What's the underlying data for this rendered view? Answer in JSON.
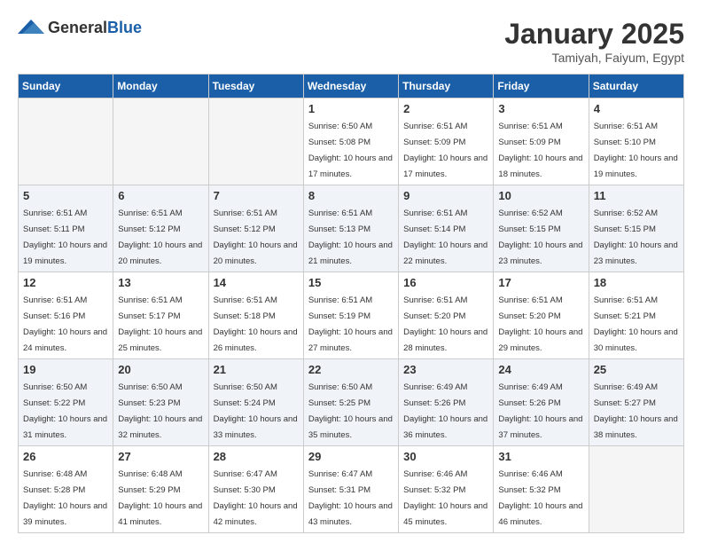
{
  "header": {
    "logo_general": "General",
    "logo_blue": "Blue",
    "title": "January 2025",
    "subtitle": "Tamiyah, Faiyum, Egypt"
  },
  "weekdays": [
    "Sunday",
    "Monday",
    "Tuesday",
    "Wednesday",
    "Thursday",
    "Friday",
    "Saturday"
  ],
  "weeks": [
    [
      {
        "day": "",
        "sunrise": "",
        "sunset": "",
        "daylight": "",
        "empty": true
      },
      {
        "day": "",
        "sunrise": "",
        "sunset": "",
        "daylight": "",
        "empty": true
      },
      {
        "day": "",
        "sunrise": "",
        "sunset": "",
        "daylight": "",
        "empty": true
      },
      {
        "day": "1",
        "sunrise": "Sunrise: 6:50 AM",
        "sunset": "Sunset: 5:08 PM",
        "daylight": "Daylight: 10 hours and 17 minutes.",
        "empty": false
      },
      {
        "day": "2",
        "sunrise": "Sunrise: 6:51 AM",
        "sunset": "Sunset: 5:09 PM",
        "daylight": "Daylight: 10 hours and 17 minutes.",
        "empty": false
      },
      {
        "day": "3",
        "sunrise": "Sunrise: 6:51 AM",
        "sunset": "Sunset: 5:09 PM",
        "daylight": "Daylight: 10 hours and 18 minutes.",
        "empty": false
      },
      {
        "day": "4",
        "sunrise": "Sunrise: 6:51 AM",
        "sunset": "Sunset: 5:10 PM",
        "daylight": "Daylight: 10 hours and 19 minutes.",
        "empty": false
      }
    ],
    [
      {
        "day": "5",
        "sunrise": "Sunrise: 6:51 AM",
        "sunset": "Sunset: 5:11 PM",
        "daylight": "Daylight: 10 hours and 19 minutes.",
        "empty": false
      },
      {
        "day": "6",
        "sunrise": "Sunrise: 6:51 AM",
        "sunset": "Sunset: 5:12 PM",
        "daylight": "Daylight: 10 hours and 20 minutes.",
        "empty": false
      },
      {
        "day": "7",
        "sunrise": "Sunrise: 6:51 AM",
        "sunset": "Sunset: 5:12 PM",
        "daylight": "Daylight: 10 hours and 20 minutes.",
        "empty": false
      },
      {
        "day": "8",
        "sunrise": "Sunrise: 6:51 AM",
        "sunset": "Sunset: 5:13 PM",
        "daylight": "Daylight: 10 hours and 21 minutes.",
        "empty": false
      },
      {
        "day": "9",
        "sunrise": "Sunrise: 6:51 AM",
        "sunset": "Sunset: 5:14 PM",
        "daylight": "Daylight: 10 hours and 22 minutes.",
        "empty": false
      },
      {
        "day": "10",
        "sunrise": "Sunrise: 6:52 AM",
        "sunset": "Sunset: 5:15 PM",
        "daylight": "Daylight: 10 hours and 23 minutes.",
        "empty": false
      },
      {
        "day": "11",
        "sunrise": "Sunrise: 6:52 AM",
        "sunset": "Sunset: 5:15 PM",
        "daylight": "Daylight: 10 hours and 23 minutes.",
        "empty": false
      }
    ],
    [
      {
        "day": "12",
        "sunrise": "Sunrise: 6:51 AM",
        "sunset": "Sunset: 5:16 PM",
        "daylight": "Daylight: 10 hours and 24 minutes.",
        "empty": false
      },
      {
        "day": "13",
        "sunrise": "Sunrise: 6:51 AM",
        "sunset": "Sunset: 5:17 PM",
        "daylight": "Daylight: 10 hours and 25 minutes.",
        "empty": false
      },
      {
        "day": "14",
        "sunrise": "Sunrise: 6:51 AM",
        "sunset": "Sunset: 5:18 PM",
        "daylight": "Daylight: 10 hours and 26 minutes.",
        "empty": false
      },
      {
        "day": "15",
        "sunrise": "Sunrise: 6:51 AM",
        "sunset": "Sunset: 5:19 PM",
        "daylight": "Daylight: 10 hours and 27 minutes.",
        "empty": false
      },
      {
        "day": "16",
        "sunrise": "Sunrise: 6:51 AM",
        "sunset": "Sunset: 5:20 PM",
        "daylight": "Daylight: 10 hours and 28 minutes.",
        "empty": false
      },
      {
        "day": "17",
        "sunrise": "Sunrise: 6:51 AM",
        "sunset": "Sunset: 5:20 PM",
        "daylight": "Daylight: 10 hours and 29 minutes.",
        "empty": false
      },
      {
        "day": "18",
        "sunrise": "Sunrise: 6:51 AM",
        "sunset": "Sunset: 5:21 PM",
        "daylight": "Daylight: 10 hours and 30 minutes.",
        "empty": false
      }
    ],
    [
      {
        "day": "19",
        "sunrise": "Sunrise: 6:50 AM",
        "sunset": "Sunset: 5:22 PM",
        "daylight": "Daylight: 10 hours and 31 minutes.",
        "empty": false
      },
      {
        "day": "20",
        "sunrise": "Sunrise: 6:50 AM",
        "sunset": "Sunset: 5:23 PM",
        "daylight": "Daylight: 10 hours and 32 minutes.",
        "empty": false
      },
      {
        "day": "21",
        "sunrise": "Sunrise: 6:50 AM",
        "sunset": "Sunset: 5:24 PM",
        "daylight": "Daylight: 10 hours and 33 minutes.",
        "empty": false
      },
      {
        "day": "22",
        "sunrise": "Sunrise: 6:50 AM",
        "sunset": "Sunset: 5:25 PM",
        "daylight": "Daylight: 10 hours and 35 minutes.",
        "empty": false
      },
      {
        "day": "23",
        "sunrise": "Sunrise: 6:49 AM",
        "sunset": "Sunset: 5:26 PM",
        "daylight": "Daylight: 10 hours and 36 minutes.",
        "empty": false
      },
      {
        "day": "24",
        "sunrise": "Sunrise: 6:49 AM",
        "sunset": "Sunset: 5:26 PM",
        "daylight": "Daylight: 10 hours and 37 minutes.",
        "empty": false
      },
      {
        "day": "25",
        "sunrise": "Sunrise: 6:49 AM",
        "sunset": "Sunset: 5:27 PM",
        "daylight": "Daylight: 10 hours and 38 minutes.",
        "empty": false
      }
    ],
    [
      {
        "day": "26",
        "sunrise": "Sunrise: 6:48 AM",
        "sunset": "Sunset: 5:28 PM",
        "daylight": "Daylight: 10 hours and 39 minutes.",
        "empty": false
      },
      {
        "day": "27",
        "sunrise": "Sunrise: 6:48 AM",
        "sunset": "Sunset: 5:29 PM",
        "daylight": "Daylight: 10 hours and 41 minutes.",
        "empty": false
      },
      {
        "day": "28",
        "sunrise": "Sunrise: 6:47 AM",
        "sunset": "Sunset: 5:30 PM",
        "daylight": "Daylight: 10 hours and 42 minutes.",
        "empty": false
      },
      {
        "day": "29",
        "sunrise": "Sunrise: 6:47 AM",
        "sunset": "Sunset: 5:31 PM",
        "daylight": "Daylight: 10 hours and 43 minutes.",
        "empty": false
      },
      {
        "day": "30",
        "sunrise": "Sunrise: 6:46 AM",
        "sunset": "Sunset: 5:32 PM",
        "daylight": "Daylight: 10 hours and 45 minutes.",
        "empty": false
      },
      {
        "day": "31",
        "sunrise": "Sunrise: 6:46 AM",
        "sunset": "Sunset: 5:32 PM",
        "daylight": "Daylight: 10 hours and 46 minutes.",
        "empty": false
      },
      {
        "day": "",
        "sunrise": "",
        "sunset": "",
        "daylight": "",
        "empty": true
      }
    ]
  ]
}
